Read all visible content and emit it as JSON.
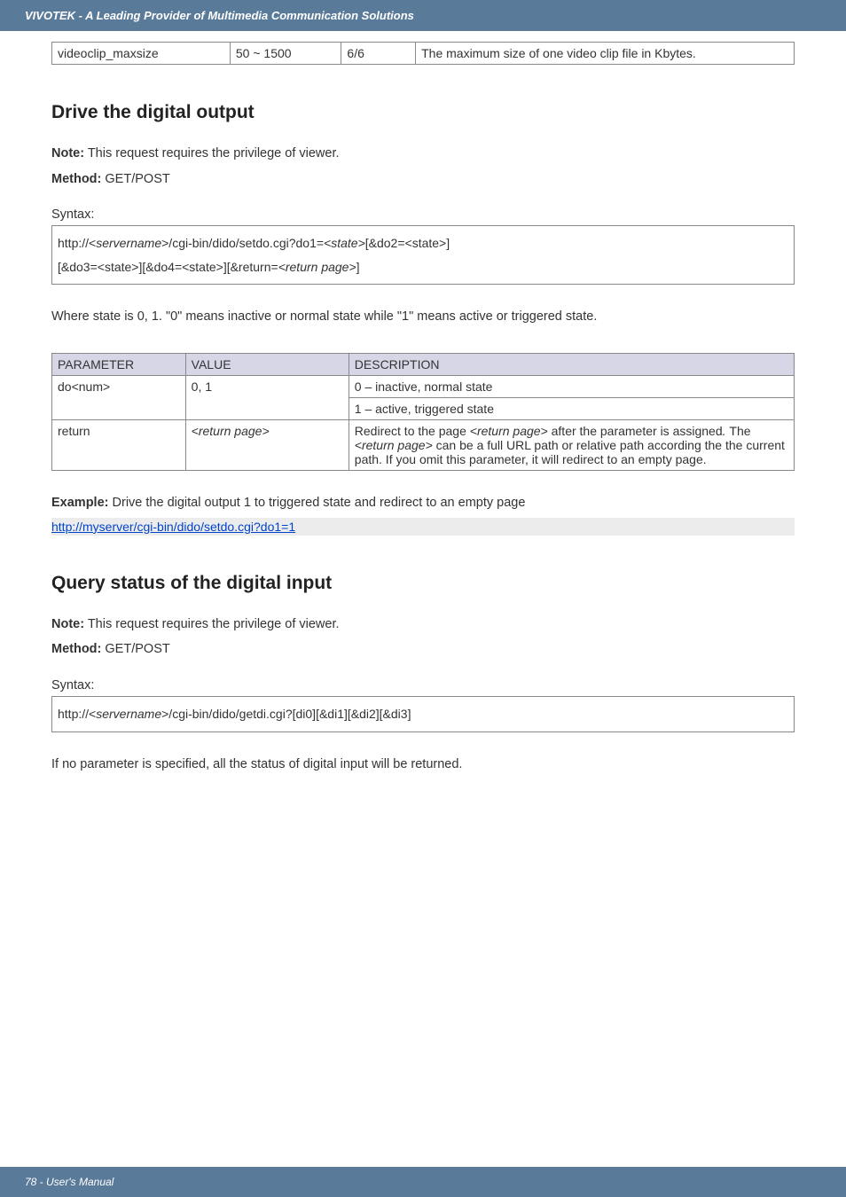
{
  "header": {
    "text": "VIVOTEK - A Leading Provider of Multimedia Communication Solutions"
  },
  "table1": {
    "r0c0": "videoclip_maxsize",
    "r0c1": "50 ~ 1500",
    "r0c2": "6/6",
    "r0c3": "The maximum size of one video clip file in Kbytes."
  },
  "section1": {
    "heading": "Drive the digital output",
    "note_label": "Note:",
    "note_text": " This request requires the privilege of viewer.",
    "method_label": "Method:",
    "method_text": " GET/POST",
    "syntax_label": "Syntax:",
    "syntax_code_line1_a": "http://<",
    "syntax_code_line1_b": "servername",
    "syntax_code_line1_c": ">/cgi-bin/dido/setdo.cgi?do1=",
    "syntax_code_line1_d": "<state>",
    "syntax_code_line1_e": "[&do2=<state>]",
    "syntax_code_line2_a": "[&do3=<state>][&do4=<state>][&return=",
    "syntax_code_line2_b": "<return page>",
    "syntax_code_line2_c": "]",
    "where_text": "Where state is 0, 1. \"0\" means inactive or normal state while \"1\" means active or triggered state."
  },
  "table2": {
    "h0": "PARAMETER",
    "h1": "VALUE",
    "h2": "DESCRIPTION",
    "r0c0": "do<num>",
    "r0c1": "0, 1",
    "r0c2a": "0 – inactive, normal state",
    "r0c2b": "1 – active, triggered state",
    "r1c0": "return",
    "r1c1": "<return page>",
    "r1c2_1a": "Redirect to the page ",
    "r1c2_1b": "<return page>",
    "r1c2_1c": " after the parameter is assigned",
    "r1c2_1d": ". ",
    "r1c2_1e": "The ",
    "r1c2_1f": "<return page>",
    "r1c2_1g": " can be a full URL path or relative path according the the current path. If you omit this parameter, it will redirect to an empty page."
  },
  "example": {
    "label": "Example:",
    "text": " Drive the digital output 1 to triggered state and redirect to an empty page",
    "link": "http://myserver/cgi-bin/dido/setdo.cgi?do1=1"
  },
  "section2": {
    "heading": "Query status of the digital input",
    "note_label": "Note:",
    "note_text": " This request requires the privilege of viewer.",
    "method_label": "Method:",
    "method_text": " GET/POST",
    "syntax_label": "Syntax:",
    "syntax_code_a": "http://<",
    "syntax_code_b": "servername",
    "syntax_code_c": ">/cgi-bin/dido/getdi.cgi?[di0][&di1][&di2][&di3]",
    "after_text": "If no parameter is specified, all the status of digital input will be returned."
  },
  "footer": {
    "text": "78 - User's Manual"
  }
}
